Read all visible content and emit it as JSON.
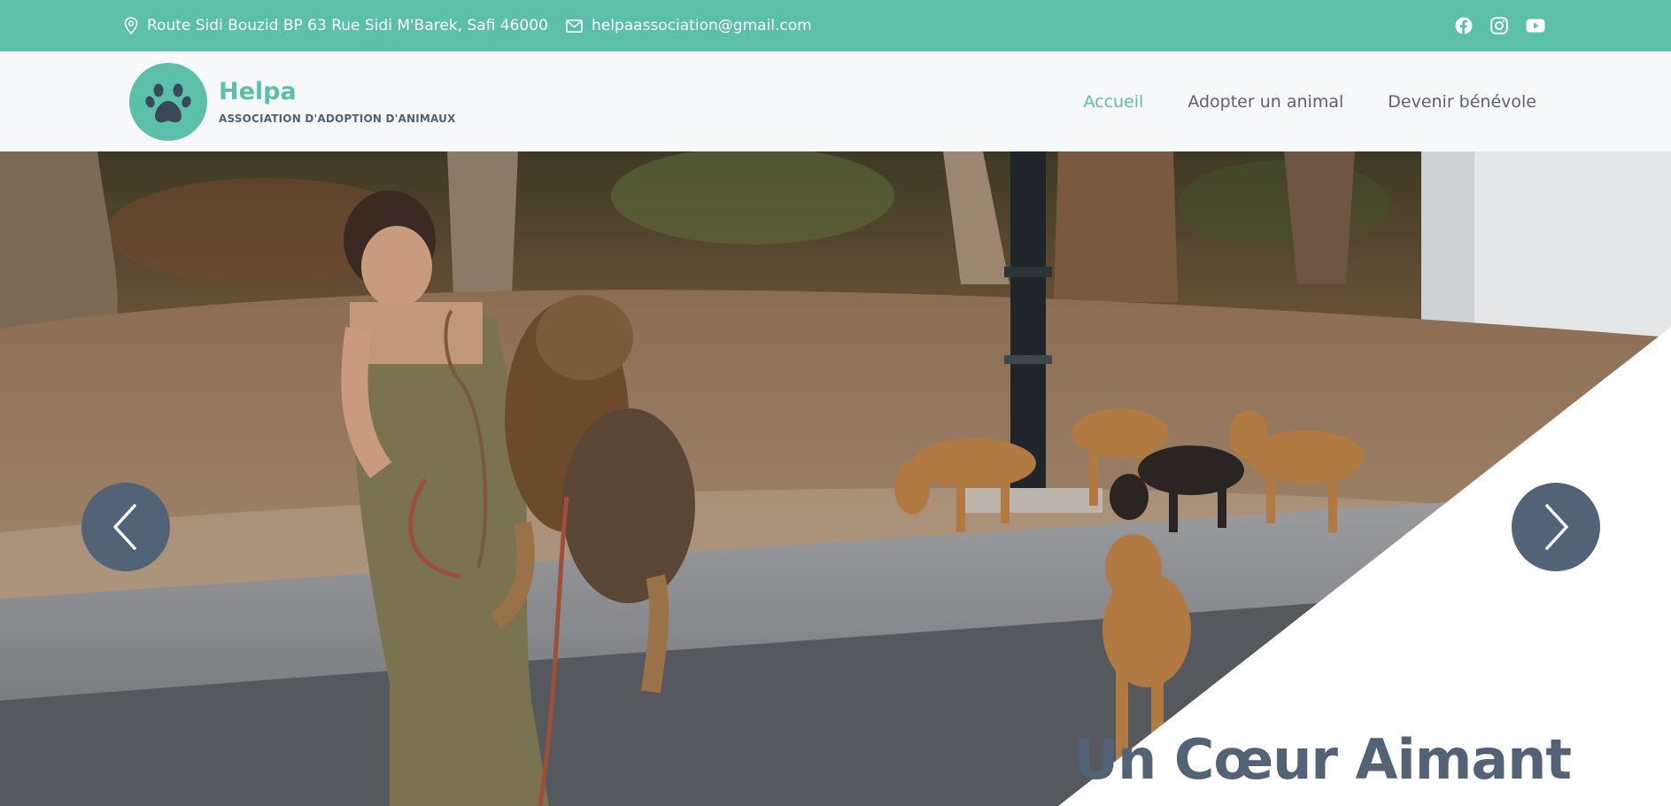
{
  "topbar": {
    "address": "Route Sidi Bouzid BP 63 Rue Sidi M'Barek, Safi 46000",
    "email": "helpaassociation@gmail.com",
    "icons": [
      "location-pin-icon",
      "envelope-icon",
      "facebook-icon",
      "instagram-icon",
      "youtube-icon"
    ]
  },
  "brand": {
    "name": "Helpa",
    "tagline": "ASSOCIATION D'ADOPTION D'ANIMAUX",
    "logo_icon": "paw-icon"
  },
  "nav": {
    "items": [
      {
        "label": "Accueil",
        "active": true
      },
      {
        "label": "Adopter un animal",
        "active": false
      },
      {
        "label": "Devenir bénévole",
        "active": false
      }
    ]
  },
  "hero": {
    "title": "Un Cœur Aimant",
    "prev_icon": "chevron-left-icon",
    "next_icon": "chevron-right-icon"
  },
  "colors": {
    "accent": "#5bbfa9",
    "slate": "#526277",
    "header_bg": "#f6f8fa"
  }
}
